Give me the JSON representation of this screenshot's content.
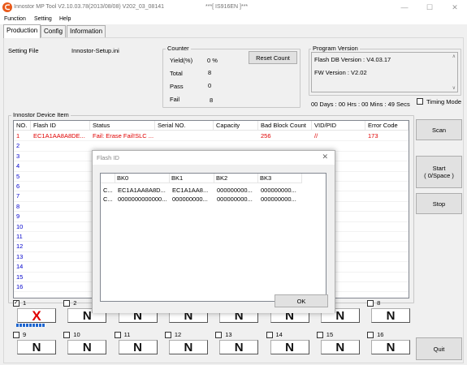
{
  "window": {
    "title_left": "Innostor MP Tool V2.10.03.78(2013/08/08)   V202_03_08141",
    "title_right": "***[ IS916EN ]***",
    "minimize": "—",
    "maximize": "☐",
    "close": "✕"
  },
  "menu": [
    "Function",
    "Setting",
    "Help"
  ],
  "tabs": [
    "Production",
    "Config",
    "Information"
  ],
  "setting_file": {
    "label": "Setting File",
    "value": "Innostor-Setup.ini"
  },
  "counter": {
    "title": "Counter",
    "yield_label": "Yield(%)",
    "yield_value": "0 %",
    "total_label": "Total",
    "total_value": "8",
    "pass_label": "Pass",
    "pass_value": "0",
    "fail_label": "Fail",
    "fail_value": "8",
    "reset_label": "Reset Count"
  },
  "program_version": {
    "title": "Program Version",
    "flash_db": "Flash DB Version :  V4.03.17",
    "fw": "FW Version :   V2.02"
  },
  "timer": "00 Days : 00 Hrs : 00 Mins : 49 Secs",
  "timing_mode_label": "Timing Mode",
  "device_group_title": "Innostor Device Item",
  "device_table": {
    "headers": [
      "NO.",
      "Flash ID",
      "Status",
      "Serial NO.",
      "Capacity",
      "Bad Block Count",
      "VID/PID",
      "Error Code"
    ],
    "rows": [
      [
        "1",
        "EC1A1AA8A8DE...",
        "Fail: Erase Fail!SLC ...",
        "",
        "",
        "256",
        "//",
        "173"
      ],
      [
        "2",
        "",
        "",
        "",
        "",
        "",
        "",
        ""
      ],
      [
        "3",
        "",
        "",
        "",
        "",
        "",
        "",
        ""
      ],
      [
        "4",
        "",
        "",
        "",
        "",
        "",
        "",
        ""
      ],
      [
        "5",
        "",
        "",
        "",
        "",
        "",
        "",
        ""
      ],
      [
        "6",
        "",
        "",
        "",
        "",
        "",
        "",
        ""
      ],
      [
        "7",
        "",
        "",
        "",
        "",
        "",
        "",
        ""
      ],
      [
        "8",
        "",
        "",
        "",
        "",
        "",
        "",
        ""
      ],
      [
        "9",
        "",
        "",
        "",
        "",
        "",
        "",
        ""
      ],
      [
        "10",
        "",
        "",
        "",
        "",
        "",
        "",
        ""
      ],
      [
        "11",
        "",
        "",
        "",
        "",
        "",
        "",
        ""
      ],
      [
        "12",
        "",
        "",
        "",
        "",
        "",
        "",
        ""
      ],
      [
        "13",
        "",
        "",
        "",
        "",
        "",
        "",
        ""
      ],
      [
        "14",
        "",
        "",
        "",
        "",
        "",
        "",
        ""
      ],
      [
        "15",
        "",
        "",
        "",
        "",
        "",
        "",
        ""
      ],
      [
        "16",
        "",
        "",
        "",
        "",
        "",
        "",
        ""
      ]
    ]
  },
  "buttons": {
    "scan": "Scan",
    "start": "Start\n( 0/Space )",
    "stop": "Stop",
    "quit": "Quit"
  },
  "slots": [
    {
      "num": "1",
      "state": "X",
      "checked": true
    },
    {
      "num": "2",
      "state": "N"
    },
    {
      "num": "3",
      "state": "N"
    },
    {
      "num": "4",
      "state": "N"
    },
    {
      "num": "5",
      "state": "N"
    },
    {
      "num": "6",
      "state": "N"
    },
    {
      "num": "7",
      "state": "N"
    },
    {
      "num": "8",
      "state": "N"
    },
    {
      "num": "9",
      "state": "N"
    },
    {
      "num": "10",
      "state": "N"
    },
    {
      "num": "11",
      "state": "N"
    },
    {
      "num": "12",
      "state": "N"
    },
    {
      "num": "13",
      "state": "N"
    },
    {
      "num": "14",
      "state": "N"
    },
    {
      "num": "15",
      "state": "N"
    },
    {
      "num": "16",
      "state": "N"
    }
  ],
  "dialog": {
    "title": "Flash ID",
    "close": "✕",
    "headers": [
      "",
      "BK0",
      "BK1",
      "BK2",
      "BK3"
    ],
    "rows": [
      [
        "C...",
        "EC1A1AA8A8D...",
        "EC1A1AA8...",
        "000000000...",
        "000000000..."
      ],
      [
        "C...",
        "0000000000000...",
        "000000000...",
        "000000000...",
        "000000000..."
      ]
    ],
    "ok": "OK"
  },
  "colors": {
    "fail_red": "#e00000",
    "x_red": "#e00000",
    "progress_blue": "#1e66d0"
  }
}
